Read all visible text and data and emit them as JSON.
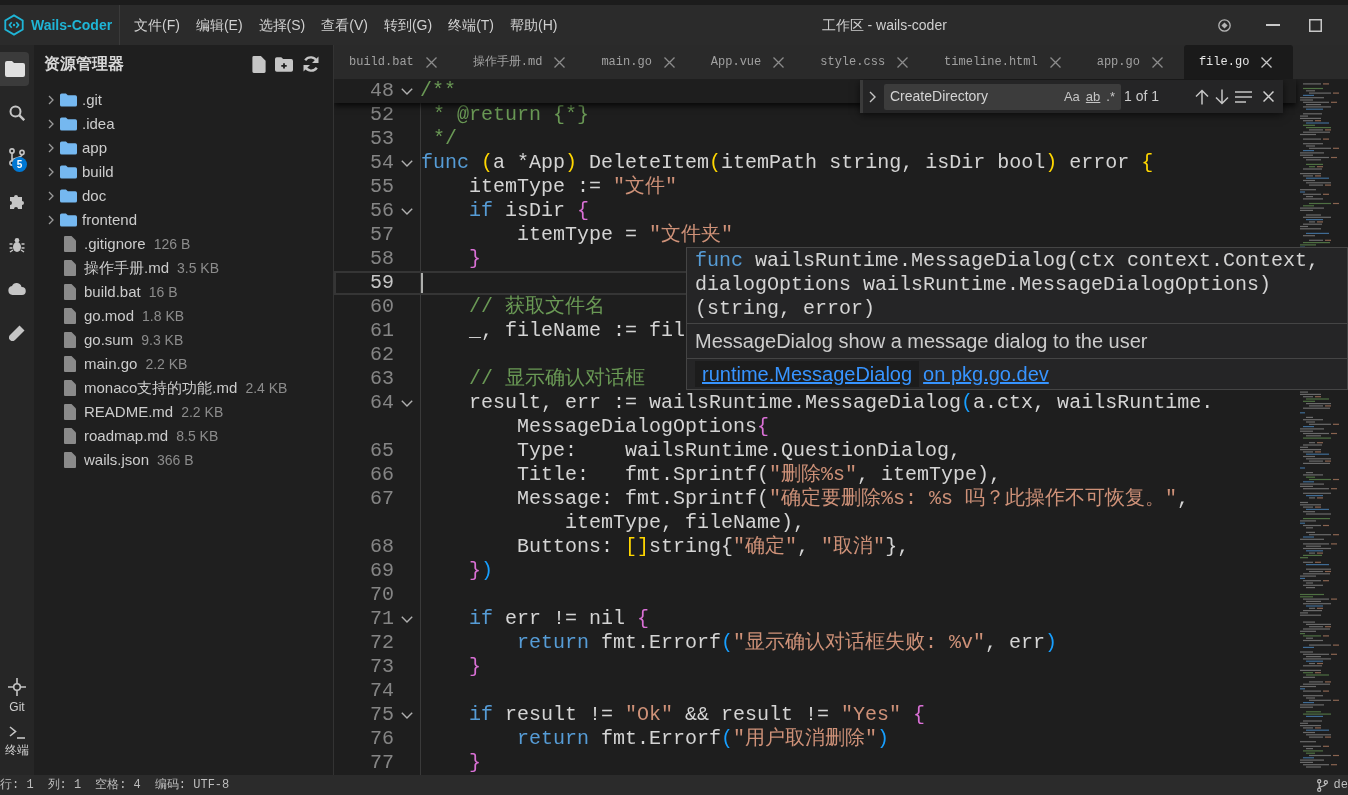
{
  "title_bar": {
    "app_name": "Wails-Coder",
    "menu": [
      "文件(F)",
      "编辑(E)",
      "选择(S)",
      "查看(V)",
      "转到(G)",
      "终端(T)",
      "帮助(H)"
    ],
    "title": "工作区 - wails-coder"
  },
  "activity_bar": {
    "items": [
      {
        "selected": true
      },
      {
        "selected": false
      },
      {
        "selected": false,
        "badge": "5"
      },
      {
        "selected": false
      },
      {
        "selected": false
      },
      {
        "selected": false
      },
      {
        "selected": false
      }
    ],
    "bottom_items": [
      {
        "label": "Git"
      },
      {
        "label": "终端"
      }
    ]
  },
  "sidebar": {
    "title": "资源管理器",
    "tree": [
      {
        "kind": "folder",
        "name": ".git",
        "expanded": false
      },
      {
        "kind": "folder",
        "name": ".idea",
        "expanded": false
      },
      {
        "kind": "folder",
        "name": "app",
        "expanded": false
      },
      {
        "kind": "folder",
        "name": "build",
        "expanded": false
      },
      {
        "kind": "folder",
        "name": "doc",
        "expanded": false
      },
      {
        "kind": "folder",
        "name": "frontend",
        "expanded": false
      },
      {
        "kind": "file",
        "name": ".gitignore",
        "size": "126 B"
      },
      {
        "kind": "file",
        "name": "操作手册.md",
        "size": "3.5 KB"
      },
      {
        "kind": "file",
        "name": "build.bat",
        "size": "16 B"
      },
      {
        "kind": "file",
        "name": "go.mod",
        "size": "1.8 KB"
      },
      {
        "kind": "file",
        "name": "go.sum",
        "size": "9.3 KB"
      },
      {
        "kind": "file",
        "name": "main.go",
        "size": "2.2 KB"
      },
      {
        "kind": "file",
        "name": "monaco支持的功能.md",
        "size": "2.4 KB"
      },
      {
        "kind": "file",
        "name": "README.md",
        "size": "2.2 KB"
      },
      {
        "kind": "file",
        "name": "roadmap.md",
        "size": "8.5 KB"
      },
      {
        "kind": "file",
        "name": "wails.json",
        "size": "366 B"
      }
    ]
  },
  "editor": {
    "tabs": [
      {
        "label": "build.bat",
        "selected": false
      },
      {
        "label": "操作手册.md",
        "selected": false
      },
      {
        "label": "main.go",
        "selected": false
      },
      {
        "label": "App.vue",
        "selected": false
      },
      {
        "label": "style.css",
        "selected": false
      },
      {
        "label": "timeline.html",
        "selected": false
      },
      {
        "label": "app.go",
        "selected": false
      },
      {
        "label": "file.go",
        "selected": true
      }
    ],
    "sticky_line": {
      "number": "48",
      "foldable": true,
      "tokens": [
        {
          "text": "/**",
          "kind": "comment"
        }
      ]
    },
    "rows": [
      {
        "number": "52",
        "foldable": false,
        "current": false,
        "tokens": [
          {
            "text": " * @return {*}",
            "kind": "comment"
          }
        ]
      },
      {
        "number": "53",
        "foldable": false,
        "current": false,
        "tokens": [
          {
            "text": " */",
            "kind": "comment"
          }
        ]
      },
      {
        "number": "54",
        "foldable": true,
        "current": false,
        "tokens": [
          {
            "text": "func",
            "kind": "keyword"
          },
          {
            "text": " (",
            "kind": "bracket_gold"
          },
          {
            "text": "a *App",
            "kind": "plain"
          },
          {
            "text": ")",
            "kind": "bracket_gold"
          },
          {
            "text": " DeleteItem",
            "kind": "plain"
          },
          {
            "text": "(",
            "kind": "bracket_gold"
          },
          {
            "text": "itemPath string, isDir bool",
            "kind": "plain"
          },
          {
            "text": ")",
            "kind": "bracket_gold"
          },
          {
            "text": " error",
            "kind": "plain"
          },
          {
            "text": " {",
            "kind": "bracket_gold"
          }
        ]
      },
      {
        "number": "55",
        "foldable": false,
        "current": false,
        "tokens": [
          {
            "text": "    itemType := ",
            "kind": "plain"
          },
          {
            "text": "\"文件\"",
            "kind": "string"
          }
        ]
      },
      {
        "number": "56",
        "foldable": true,
        "current": false,
        "tokens": [
          {
            "text": "    if",
            "kind": "keyword"
          },
          {
            "text": " isDir",
            "kind": "plain"
          },
          {
            "text": " {",
            "kind": "bracket_purple"
          }
        ]
      },
      {
        "number": "57",
        "foldable": false,
        "current": false,
        "tokens": [
          {
            "text": "        itemType = ",
            "kind": "plain"
          },
          {
            "text": "\"文件夹\"",
            "kind": "string"
          }
        ]
      },
      {
        "number": "58",
        "foldable": false,
        "current": false,
        "tokens": [
          {
            "text": "    }",
            "kind": "bracket_purple"
          }
        ]
      },
      {
        "number": "59",
        "foldable": false,
        "current": true
      },
      {
        "number": "60",
        "foldable": false,
        "current": false,
        "tokens": [
          {
            "text": "    // 获取文件名",
            "kind": "comment"
          }
        ]
      },
      {
        "number": "61",
        "foldable": false,
        "current": false,
        "tokens": [
          {
            "text": "    _, fileName := fil",
            "kind": "plain"
          }
        ]
      },
      {
        "number": "62",
        "foldable": false,
        "current": false
      },
      {
        "number": "63",
        "foldable": false,
        "current": false,
        "tokens": [
          {
            "text": "    // 显示确认对话框",
            "kind": "comment"
          }
        ]
      },
      {
        "number": "64",
        "foldable": true,
        "current": false,
        "tokens": [
          {
            "text": "    result, err := wailsRuntime.MessageDialog",
            "kind": "plain"
          },
          {
            "text": "(",
            "kind": "bracket_blue"
          },
          {
            "text": "a.ctx, wailsRuntime.",
            "kind": "plain"
          }
        ]
      },
      {
        "foldable": false,
        "current": false,
        "tokens": [
          {
            "text": "        MessageDialogOptions",
            "kind": "plain"
          },
          {
            "text": "{",
            "kind": "bracket_purple"
          }
        ]
      },
      {
        "number": "65",
        "foldable": false,
        "current": false,
        "tokens": [
          {
            "text": "        Type:    wailsRuntime.QuestionDialog,",
            "kind": "plain"
          }
        ]
      },
      {
        "number": "66",
        "foldable": false,
        "current": false,
        "tokens": [
          {
            "text": "        Title:   fmt.Sprintf(",
            "kind": "plain"
          },
          {
            "text": "\"删除%s\"",
            "kind": "string"
          },
          {
            "text": ", itemType),",
            "kind": "plain"
          }
        ]
      },
      {
        "number": "67",
        "foldable": false,
        "current": false,
        "tokens": [
          {
            "text": "        Message: fmt.Sprintf(",
            "kind": "plain"
          },
          {
            "text": "\"确定要删除%s: %s 吗？此操作不可恢复。\"",
            "kind": "string"
          },
          {
            "text": ",",
            "kind": "plain"
          }
        ]
      },
      {
        "foldable": false,
        "current": false,
        "tokens": [
          {
            "text": "            itemType, fileName),",
            "kind": "plain"
          }
        ]
      },
      {
        "number": "68",
        "foldable": false,
        "current": false,
        "tokens": [
          {
            "text": "        Buttons: ",
            "kind": "plain"
          },
          {
            "text": "[]",
            "kind": "bracket_gold"
          },
          {
            "text": "string{",
            "kind": "plain"
          },
          {
            "text": "\"确定\"",
            "kind": "string"
          },
          {
            "text": ", ",
            "kind": "plain"
          },
          {
            "text": "\"取消\"",
            "kind": "string"
          },
          {
            "text": "},",
            "kind": "plain"
          }
        ]
      },
      {
        "number": "69",
        "foldable": false,
        "current": false,
        "tokens": [
          {
            "text": "    }",
            "kind": "bracket_purple"
          },
          {
            "text": ")",
            "kind": "bracket_blue"
          }
        ]
      },
      {
        "number": "70",
        "foldable": false,
        "current": false
      },
      {
        "number": "71",
        "foldable": true,
        "current": false,
        "tokens": [
          {
            "text": "    if",
            "kind": "keyword"
          },
          {
            "text": " err != nil",
            "kind": "plain"
          },
          {
            "text": " {",
            "kind": "bracket_purple"
          }
        ]
      },
      {
        "number": "72",
        "foldable": false,
        "current": false,
        "tokens": [
          {
            "text": "        return",
            "kind": "keyword"
          },
          {
            "text": " fmt.Errorf",
            "kind": "plain"
          },
          {
            "text": "(",
            "kind": "bracket_blue"
          },
          {
            "text": "\"显示确认对话框失败: %v\"",
            "kind": "string"
          },
          {
            "text": ", err",
            "kind": "plain"
          },
          {
            "text": ")",
            "kind": "bracket_blue"
          }
        ]
      },
      {
        "number": "73",
        "foldable": false,
        "current": false,
        "tokens": [
          {
            "text": "    }",
            "kind": "bracket_purple"
          }
        ]
      },
      {
        "number": "74",
        "foldable": false,
        "current": false
      },
      {
        "number": "75",
        "foldable": true,
        "current": false,
        "tokens": [
          {
            "text": "    if",
            "kind": "keyword"
          },
          {
            "text": " result != ",
            "kind": "plain"
          },
          {
            "text": "\"Ok\"",
            "kind": "string"
          },
          {
            "text": " && result != ",
            "kind": "plain"
          },
          {
            "text": "\"Yes\"",
            "kind": "string"
          },
          {
            "text": " {",
            "kind": "bracket_purple"
          }
        ]
      },
      {
        "number": "76",
        "foldable": false,
        "current": false,
        "tokens": [
          {
            "text": "        return",
            "kind": "keyword"
          },
          {
            "text": " fmt.Errorf",
            "kind": "plain"
          },
          {
            "text": "(",
            "kind": "bracket_blue"
          },
          {
            "text": "\"用户取消删除\"",
            "kind": "string"
          },
          {
            "text": ")",
            "kind": "bracket_blue"
          }
        ]
      },
      {
        "number": "77",
        "foldable": false,
        "current": false,
        "tokens": [
          {
            "text": "    }",
            "kind": "bracket_purple"
          }
        ]
      }
    ],
    "find_widget": {
      "value": "CreateDirectory",
      "options": [
        "Aa",
        "ab",
        ".*"
      ],
      "match_count": "1 of 1"
    },
    "hover": {
      "signature": [
        {
          "tokens": [
            {
              "text": "func",
              "kind": "keyword"
            },
            {
              "text": " wailsRuntime.MessageDialog(ctx context.Context,",
              "kind": "plain"
            }
          ]
        },
        {
          "tokens": [
            {
              "text": "dialogOptions wailsRuntime.MessageDialogOptions)",
              "kind": "plain"
            }
          ]
        },
        {
          "tokens": [
            {
              "text": "(string, error)",
              "kind": "plain"
            }
          ]
        }
      ],
      "description": "MessageDialog show a message dialog to the user",
      "links": [
        {
          "text": "runtime.MessageDialog",
          "focused": true
        },
        {
          "text": "on pkg.go.dev",
          "focused": false
        }
      ]
    }
  },
  "status_bar": {
    "items": [
      "行: 1",
      "列: 1",
      "空格: 4",
      "编码: UTF-8"
    ],
    "branch": "de"
  }
}
